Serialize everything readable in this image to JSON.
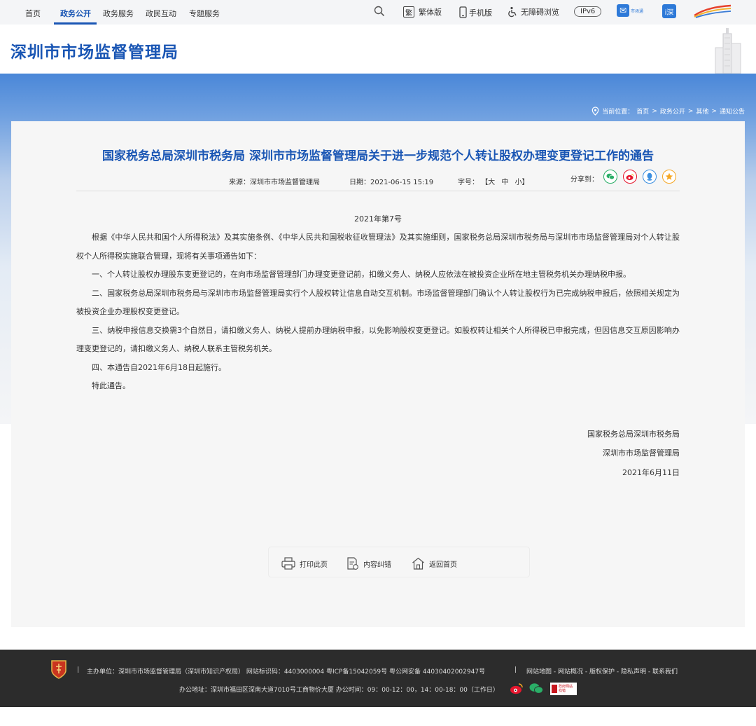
{
  "nav": {
    "items": [
      "首页",
      "政务公开",
      "政务服务",
      "政民互动",
      "专题服务"
    ],
    "active_index": 1
  },
  "utilities": {
    "traditional": "繁体版",
    "traditional_icon_glyph": "繁",
    "mobile": "手机版",
    "accessible": "无障碍浏览",
    "ipv6": "IPv6",
    "market_app": "市场通",
    "app_glyph": "i深"
  },
  "header": {
    "site_title": "深圳市市场监督管理局"
  },
  "breadcrumb": {
    "label": "当前位置：",
    "items": [
      "首页",
      "政务公开",
      "其他",
      "通知公告"
    ],
    "separator": ">"
  },
  "article": {
    "title": "国家税务总局深圳市税务局 深圳市市场监督管理局关于进一步规范个人转让股权办理变更登记工作的通告",
    "source": "来源：深圳市市场监督管理局",
    "date": "日期：2021-06-15 15:19",
    "font_size_label": "字号：",
    "font_sizes": [
      "【大",
      "中",
      "小】"
    ],
    "share_label": "分享到：",
    "doc_number": "2021年第7号",
    "paragraphs": [
      "根据《中华人民共和国个人所得税法》及其实施条例、《中华人民共和国税收征收管理法》及其实施细则，国家税务总局深圳市税务局与深圳市市场监督管理局对个人转让股权个人所得税实施联合管理，现将有关事项通告如下：",
      "一、个人转让股权办理股东变更登记的，在向市场监督管理部门办理变更登记前，扣缴义务人、纳税人应依法在被投资企业所在地主管税务机关办理纳税申报。",
      "二、国家税务总局深圳市税务局与深圳市市场监督管理局实行个人股权转让信息自动交互机制。市场监督管理部门确认个人转让股权行为已完成纳税申报后，依照相关规定为被投资企业办理股权变更登记。",
      "三、纳税申报信息交换需3个自然日，请扣缴义务人、纳税人提前办理纳税申报，以免影响股权变更登记。如股权转让相关个人所得税已申报完成，但因信息交互原因影响办理变更登记的，请扣缴义务人、纳税人联系主管税务机关。",
      "四、本通告自2021年6月18日起施行。",
      "特此通告。"
    ],
    "signatures": [
      "国家税务总局深圳市税务局",
      "深圳市市场监督管理局",
      "2021年6月11日"
    ]
  },
  "tools": {
    "print": "打印此页",
    "correct": "内容纠错",
    "home": "返回首页"
  },
  "footer": {
    "line1": "主办单位：深圳市市场监督管理局（深圳市知识产权局）   网站标识码：4403000004   粤ICP备15042059号   粤公网安备 44030402002947号",
    "links": [
      "网站地图",
      "网站概况",
      "版权保护",
      "隐私声明",
      "联系我们"
    ],
    "line2": "办公地址：深圳市福田区深南大道7010号工商物价大厦 办公时间：09：00-12：00，14：00-18：00（工作日）",
    "gov_badge": "政府网站 找错"
  },
  "colors": {
    "brand_blue": "#1a56b4",
    "footer_bg": "#2c2c2c",
    "wechat": "#2aae67",
    "weibo": "#e6162d",
    "qq": "#3b8fe0",
    "qzone": "#f5a623"
  }
}
